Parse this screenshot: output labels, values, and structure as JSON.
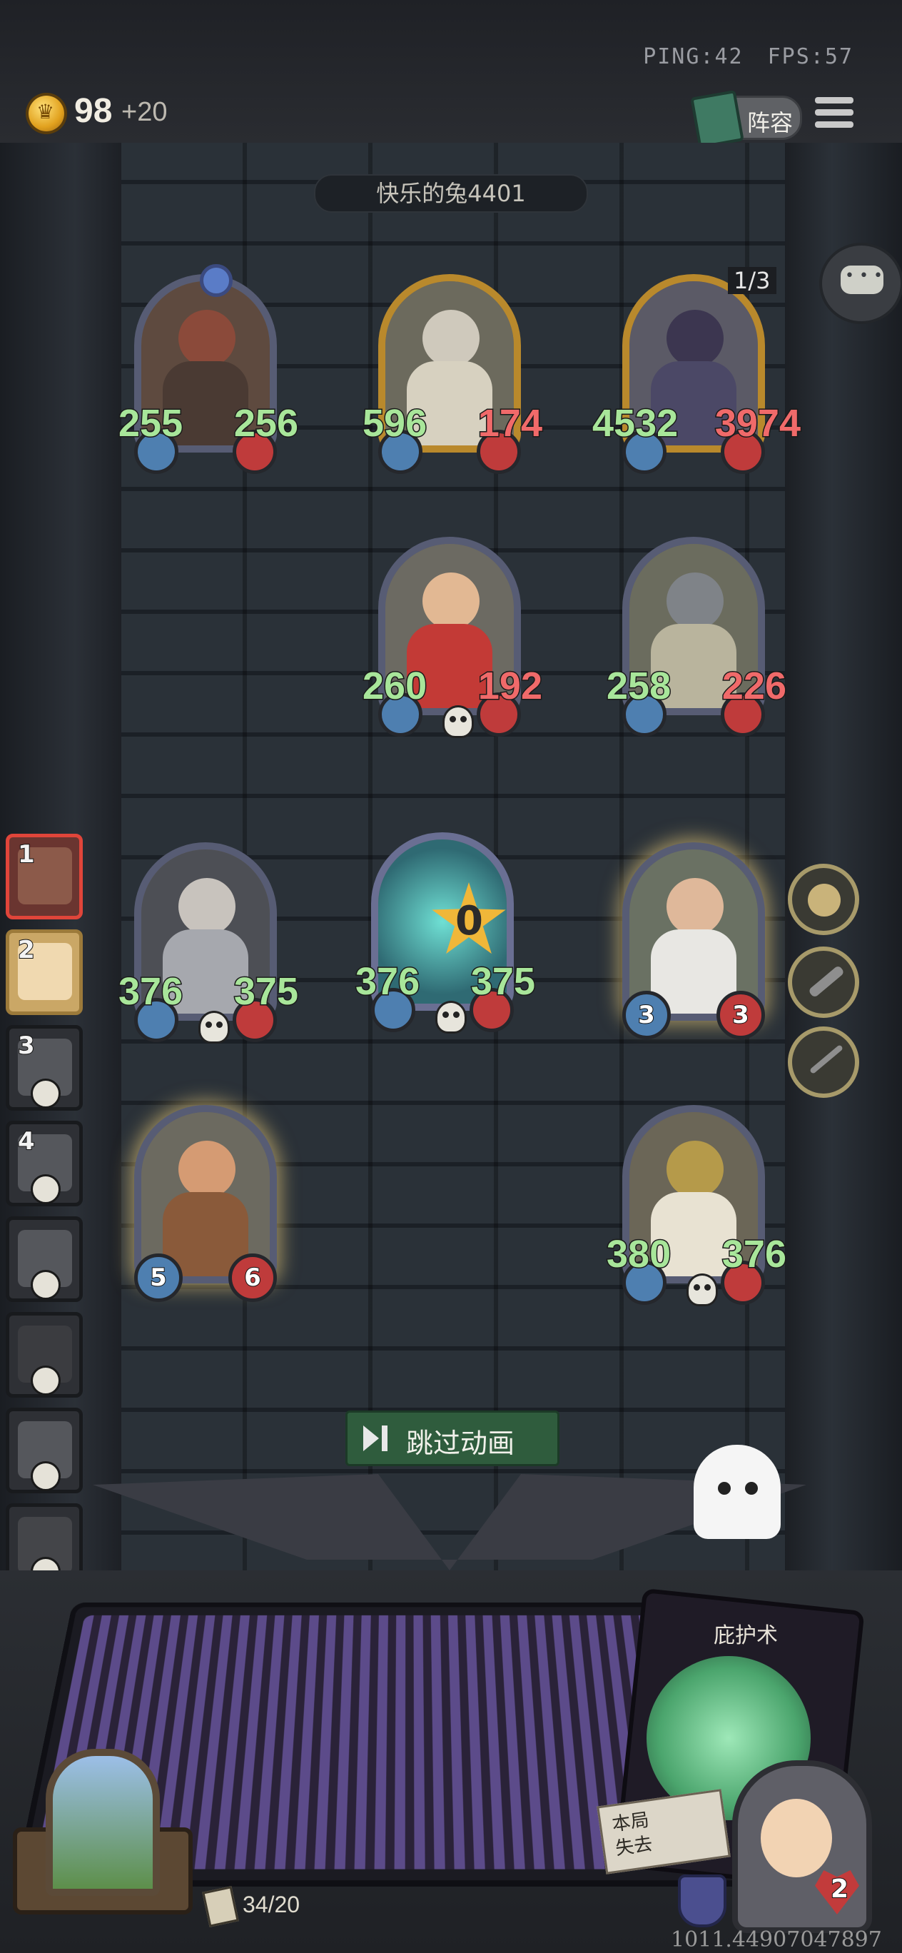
{
  "hud": {
    "ping": "PING:42",
    "fps": "FPS:57",
    "gold": "98",
    "gold_income": "+20",
    "lineup_label": "阵容"
  },
  "opponent_name": "快乐的兔4401",
  "board": {
    "row1": [
      {
        "atk": "255",
        "hp": "256"
      },
      {
        "atk": "596",
        "hp": "174"
      },
      {
        "atk": "4532",
        "hp": "3974"
      }
    ],
    "row1_counter": "1/3",
    "row2": [
      {
        "atk": "260",
        "hp": "192"
      },
      {
        "atk": "258",
        "hp": "226"
      }
    ],
    "row3": [
      {
        "atk": "376",
        "hp": "375"
      },
      {
        "atk": "376",
        "hp": "375",
        "star": "0"
      },
      {
        "atk": "3",
        "hp": "3"
      }
    ],
    "row4": [
      {
        "atk": "5",
        "hp": "6"
      },
      {
        "atk": "380",
        "hp": "376"
      }
    ]
  },
  "turn_order": [
    "1",
    "2",
    "3",
    "4"
  ],
  "skip_label": "跳过动画",
  "spell": {
    "title": "庇护术",
    "ribbon_text": "本局\n失去"
  },
  "hero_hp": "2",
  "deck_count": "34/20",
  "coordinate_text": "1011.44907047897",
  "icons": [
    "coin-icon",
    "book-icon",
    "menu-icon",
    "chat-icon",
    "skull-icon",
    "pocket-watch-icon",
    "pistol-icon",
    "dagger-icon",
    "play-skip-icon",
    "ghost-icon",
    "shield-icon",
    "heart-icon",
    "card-icon"
  ]
}
